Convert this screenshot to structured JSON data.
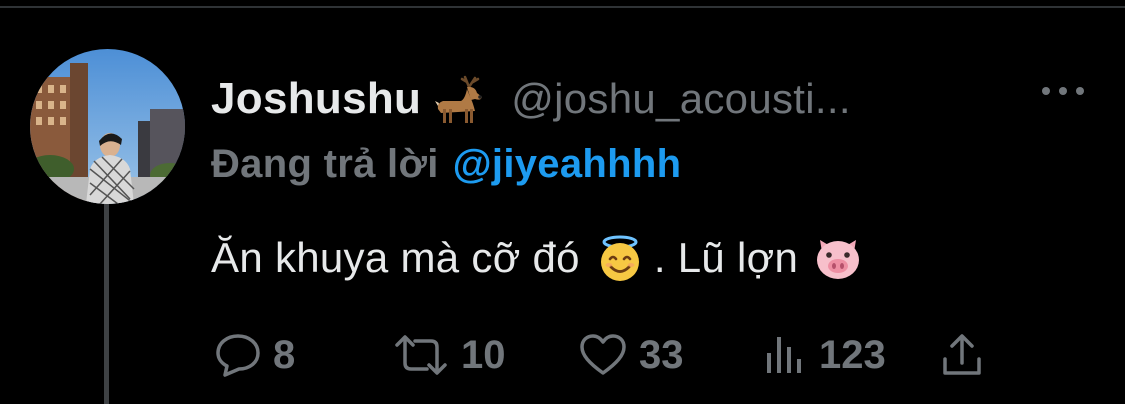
{
  "tweet": {
    "display_name": "Joshushu",
    "name_emoji": "deer-emoji",
    "handle": "@joshu_acousti...",
    "reply_prefix": "Đang trả lời",
    "reply_mention": "@jiyeahhhh",
    "text_part1": "Ăn khuya mà cỡ đó",
    "text_emoji1": "smiling-face-with-halo-emoji",
    "text_part2": ". Lũ lợn",
    "text_emoji2": "pig-face-emoji"
  },
  "actions": {
    "reply_count": "8",
    "retweet_count": "10",
    "like_count": "33",
    "views_count": "123"
  },
  "colors": {
    "background": "#000000",
    "primary_text": "#e7e9ea",
    "secondary_text": "#71767b",
    "accent": "#1d9bf0",
    "thread_line": "#3e4144"
  }
}
